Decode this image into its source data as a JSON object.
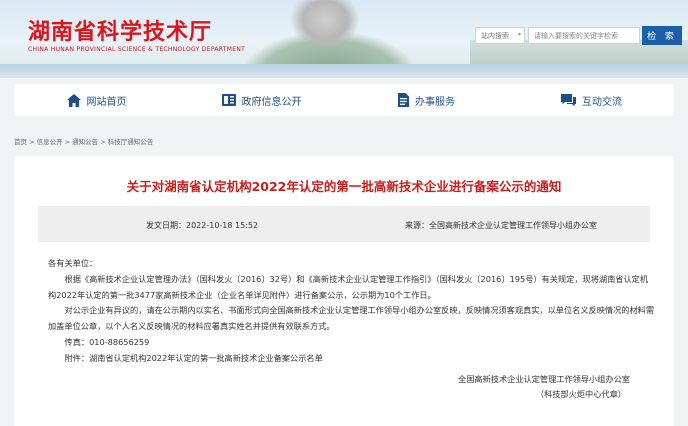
{
  "header": {
    "title": "湖南省科学技术厅",
    "subtitle": "CHINA HUNAN PROVINCIAL SCIENCE & TECHNOLOGY DEPARTMENT",
    "search_scope": "站内搜索",
    "search_placeholder": "请输入要搜索的关键字检索",
    "search_button": "检 索"
  },
  "nav": [
    {
      "label": "网站首页",
      "icon": "home-icon"
    },
    {
      "label": "政府信息公开",
      "icon": "book-icon"
    },
    {
      "label": "办事服务",
      "icon": "document-icon"
    },
    {
      "label": "互动交流",
      "icon": "chat-icon"
    }
  ],
  "breadcrumb": "首页 > 信息公开 > 通知公告 > 科技厅通知公告",
  "article": {
    "title": "关于对湖南省认定机构2022年认定的第一批高新技术企业进行备案公示的通知",
    "time": "发文日期：2022-10-18 15:52",
    "source": "来源：全国高新技术企业认定管理工作领导小组办公室",
    "paragraphs": [
      "各有关单位：",
      "根据《高新技术企业认定管理办法》（国科发火〔2016〕32号）和《高新技术企业认定管理工作指引》（国科发火〔2016〕195号）有关规定，现将湖南省认定机构2022年认定的第一批3477家高新技术企业（企业名单详见附件）进行备案公示，公示期为10个工作日。",
      "对公示企业有异议的，请在公示期内以实名、书面形式向全国高新技术企业认定管理工作领导小组办公室反映，反映情况须客观真实，以单位名义反映情况的材料需加盖单位公章，以个人名义反映情况的材料应署真实姓名并提供有效联系方式。",
      "传真：010-88656259",
      "附件：湖南省认定机构2022年认定的第一批高新技术企业备案公示名单"
    ],
    "signature": "全国高新技术企业认定管理工作领导小组办公室",
    "signature_note": "（科技部火炬中心代章）"
  },
  "colors": {
    "title_red": "#c81e1e",
    "nav_blue": "#1d4f8a",
    "button_blue": "#1a5fa8"
  }
}
